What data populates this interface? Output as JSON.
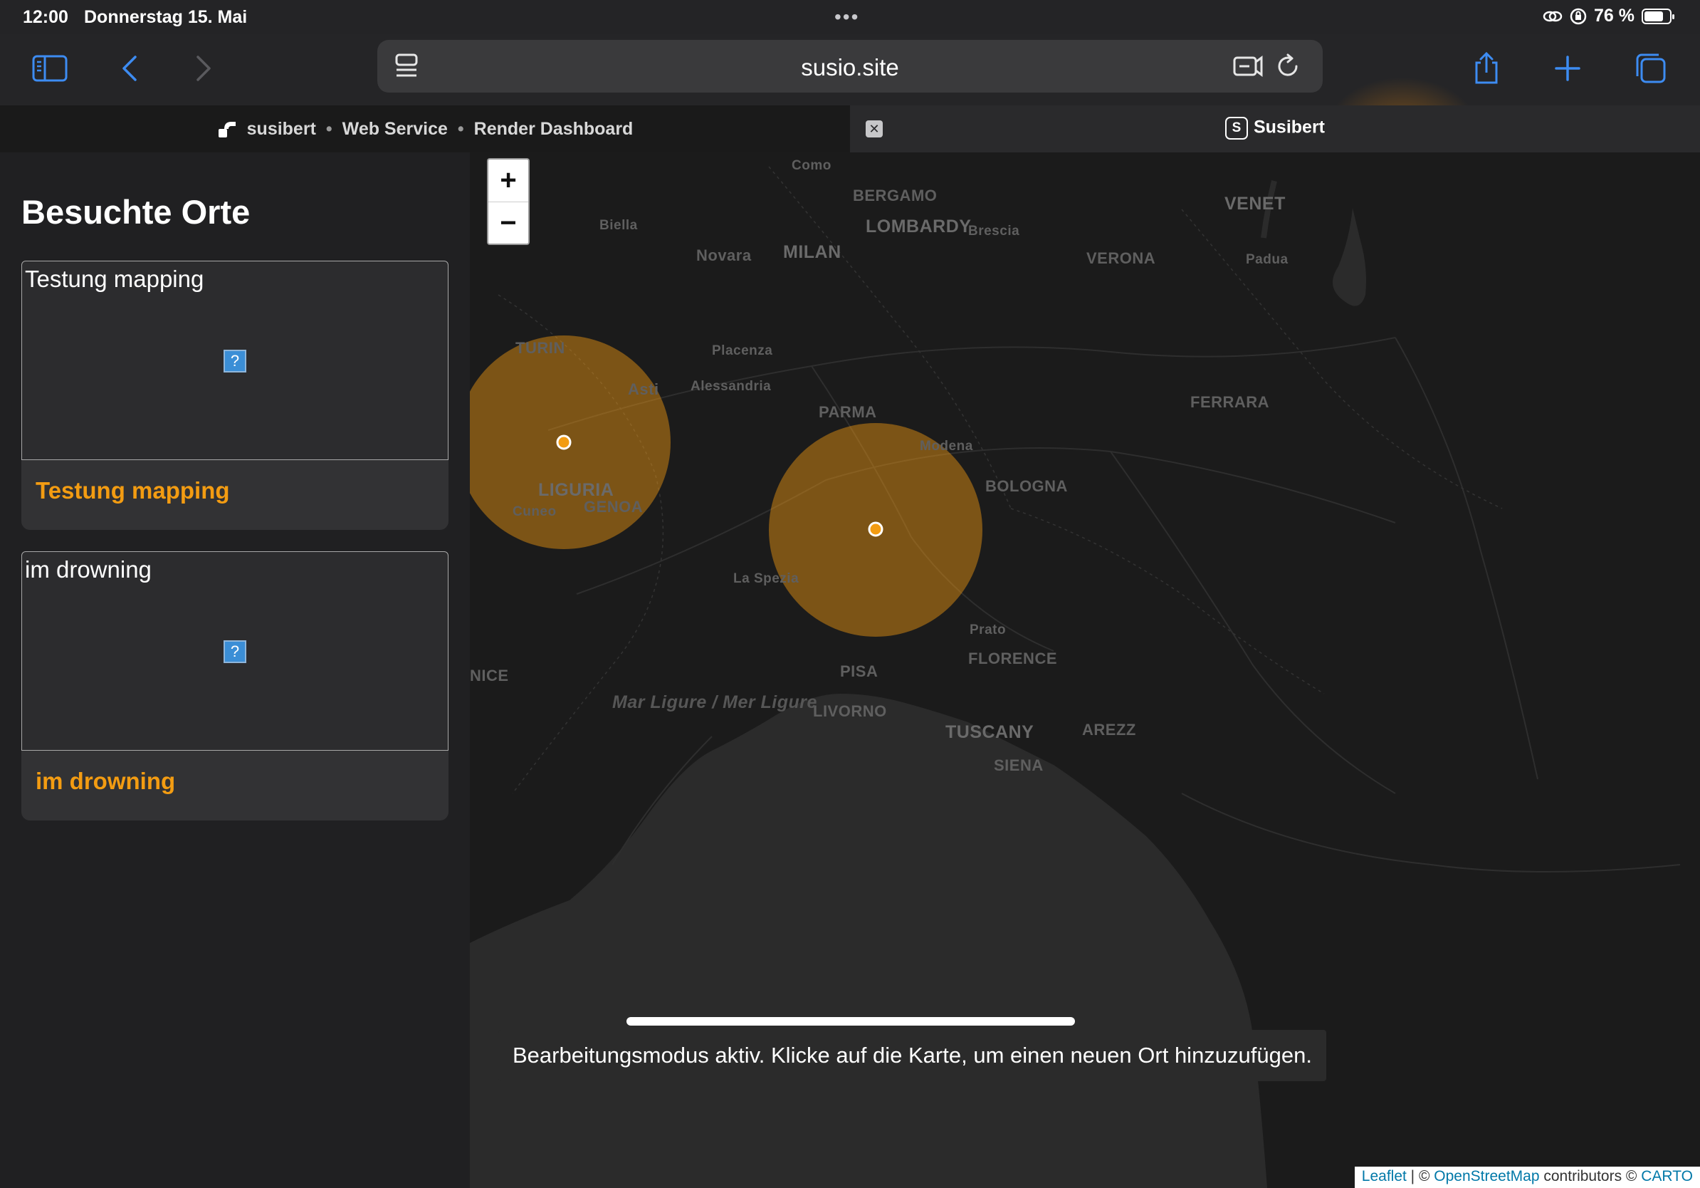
{
  "status_bar": {
    "time": "12:00",
    "date": "Donnerstag 15. Mai",
    "battery": "76 %",
    "battery_level": 0.76
  },
  "browser": {
    "url": "susio.site",
    "tabs": [
      {
        "parts": [
          "susibert",
          "Web Service",
          "Render Dashboard"
        ]
      },
      {
        "title": "Susibert",
        "icon_letter": "S"
      }
    ]
  },
  "sidebar": {
    "title": "Besuchte Orte",
    "places": [
      {
        "image_alt": "Testung mapping",
        "title": "Testung mapping"
      },
      {
        "image_alt": "im drowning",
        "title": "im drowning"
      }
    ]
  },
  "map": {
    "zoom_in": "+",
    "zoom_out": "−",
    "labels": {
      "como": "Como",
      "bergamo": "BERGAMO",
      "lombardy": "LOMBARDY",
      "brescia": "Brescia",
      "venet": "VENET",
      "biella": "Biella",
      "novara": "Novara",
      "milan": "MILAN",
      "verona": "VERONA",
      "padua": "Padua",
      "turin": "TURIN",
      "placenza": "Placenza",
      "asti": "Asti",
      "alessandria": "Alessandria",
      "parma": "PARMA",
      "ferrara": "FERRARA",
      "modena": "Modena",
      "liguria": "LIGURIA",
      "genoa": "GENOA",
      "bologna": "BOLOGNA",
      "cuneo": "Cuneo",
      "la_spezia": "La Spezia",
      "prato": "Prato",
      "florence": "FLORENCE",
      "nice": "NICE",
      "pisa": "PISA",
      "livorno": "LIVORNO",
      "tuscany": "TUSCANY",
      "arezzo": "AREZZ",
      "siena": "SIENA",
      "sea": "Mar Ligure / Mer Ligure"
    },
    "toast": "Bearbeitungsmodus aktiv. Klicke auf die Karte, um einen neuen Ort hinzuzufügen.",
    "attribution": {
      "leaflet": "Leaflet",
      "sep": " | © ",
      "osm": "OpenStreetMap",
      "contributors": " contributors © ",
      "carto": "CARTO"
    },
    "marker_color": "#f39c12"
  }
}
